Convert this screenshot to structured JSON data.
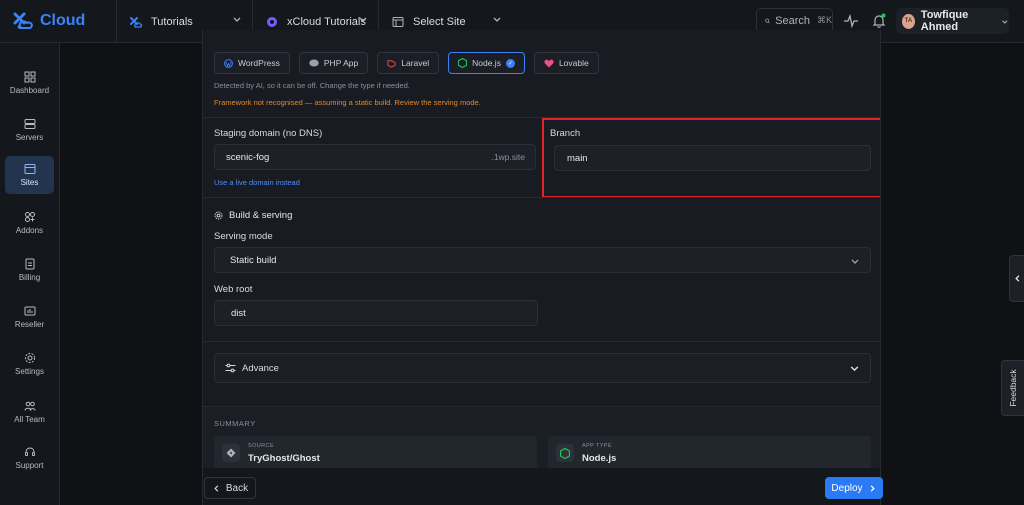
{
  "app": {
    "logo_text": "Cloud",
    "brand_color": "#3b82f6"
  },
  "breadcrumbs": [
    {
      "label": "Tutorials"
    },
    {
      "label": "xCloud Tutorials"
    },
    {
      "label": "Select Site"
    }
  ],
  "search": {
    "label": "Search",
    "shortcut": "⌘K"
  },
  "user": {
    "initials": "TA",
    "name": "Towfique Ahmed"
  },
  "sidebar": {
    "items": [
      {
        "label": "Dashboard"
      },
      {
        "label": "Servers"
      },
      {
        "label": "Sites",
        "active": true
      },
      {
        "label": "Addons"
      },
      {
        "label": "Billing"
      },
      {
        "label": "Reseller"
      },
      {
        "label": "Settings"
      },
      {
        "label": "All Team"
      },
      {
        "label": "Support"
      }
    ]
  },
  "app_types": [
    {
      "label": "WordPress",
      "icon": "wordpress-icon"
    },
    {
      "label": "PHP App",
      "icon": "php-icon"
    },
    {
      "label": "Laravel",
      "icon": "laravel-icon"
    },
    {
      "label": "Node.js",
      "icon": "nodejs-icon",
      "selected": true
    },
    {
      "label": "Lovable",
      "icon": "lovable-icon"
    }
  ],
  "detected_hint": "Detected by AI, so it can be off. Change the type if needed.",
  "warning": "Framework not recognised — assuming a static build. Review the serving mode.",
  "staging": {
    "label": "Staging domain (no DNS)",
    "value": "scenic-fog",
    "suffix": ".1wp.site",
    "link": "Use a live domain instead"
  },
  "branch": {
    "label": "Branch",
    "value": "main"
  },
  "build": {
    "title": "Build & serving",
    "serving_mode_label": "Serving mode",
    "serving_mode_value": "Static build",
    "web_root_label": "Web root",
    "web_root_value": "dist"
  },
  "advance": {
    "label": "Advance"
  },
  "summary": {
    "title": "SUMMARY",
    "source_label": "SOURCE",
    "source_value": "TryGhost/Ghost",
    "app_type_label": "APP TYPE",
    "app_type_value": "Node.js"
  },
  "footer": {
    "back_label": "Back",
    "deploy_label": "Deploy"
  },
  "feedback": {
    "label": "Feedback"
  }
}
